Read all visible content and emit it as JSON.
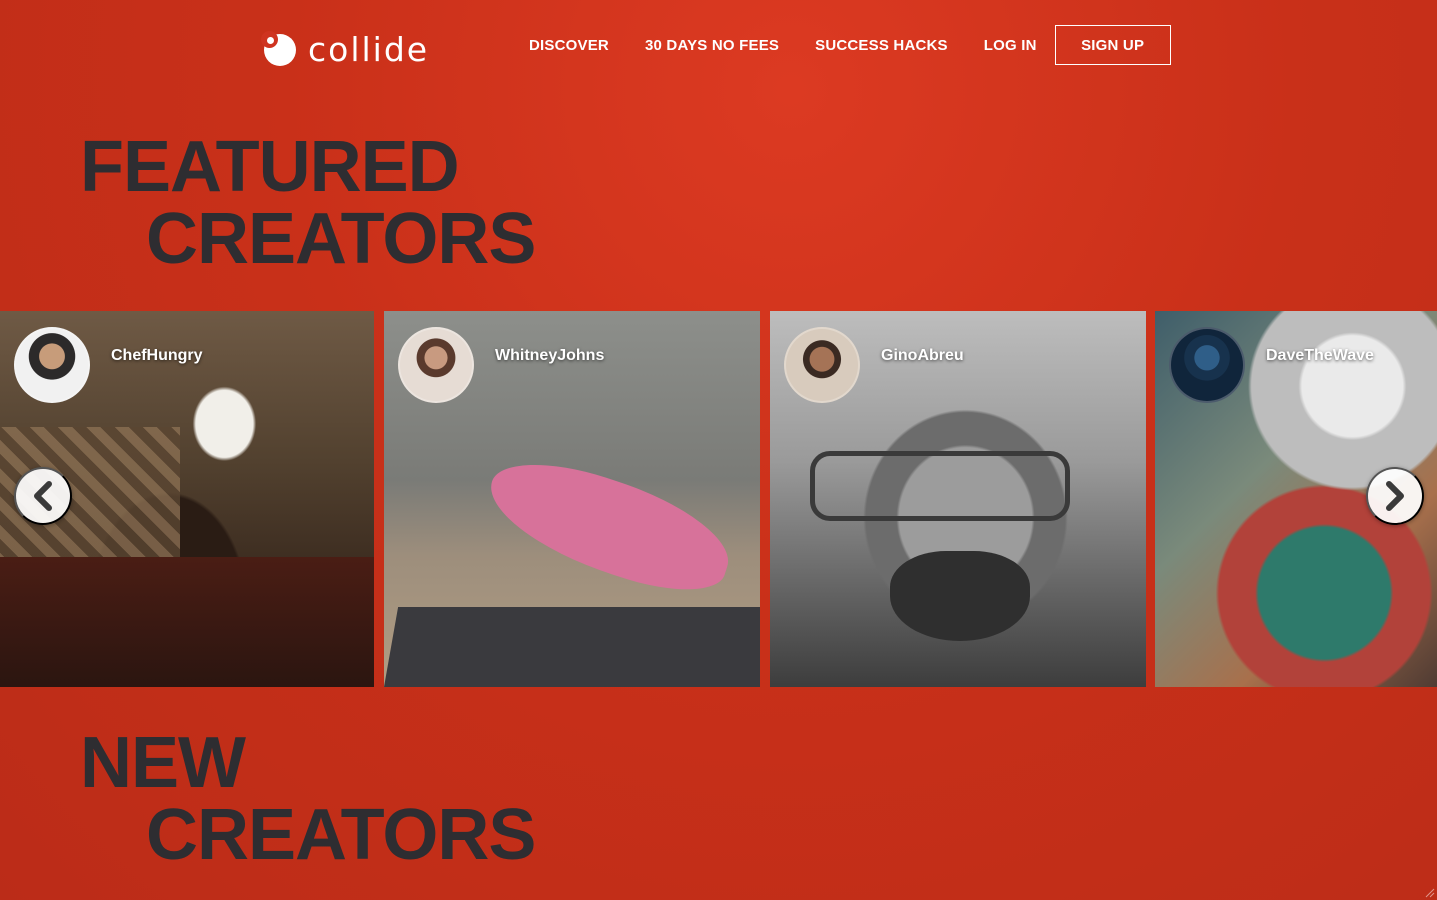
{
  "brand": {
    "name": "collide",
    "logo_icon": "collide-logo-icon"
  },
  "nav": {
    "items": [
      "DISCOVER",
      "30 DAYS NO FEES",
      "SUCCESS HACKS",
      "LOG IN"
    ],
    "signup_label": "SIGN UP"
  },
  "featured": {
    "title_line1": "FEATURED",
    "title_line2": "CREATORS"
  },
  "creators": [
    {
      "name": "ChefHungry"
    },
    {
      "name": "WhitneyJohns"
    },
    {
      "name": "GinoAbreu"
    },
    {
      "name": "DaveTheWave"
    }
  ],
  "carousel": {
    "prev_icon": "chevron-left-icon",
    "next_icon": "chevron-right-icon"
  },
  "new_section": {
    "title_line1": "NEW",
    "title_line2": "CREATORS"
  },
  "colors": {
    "background": "#cf3420",
    "heading": "#2e2d31",
    "text": "#ffffff"
  }
}
